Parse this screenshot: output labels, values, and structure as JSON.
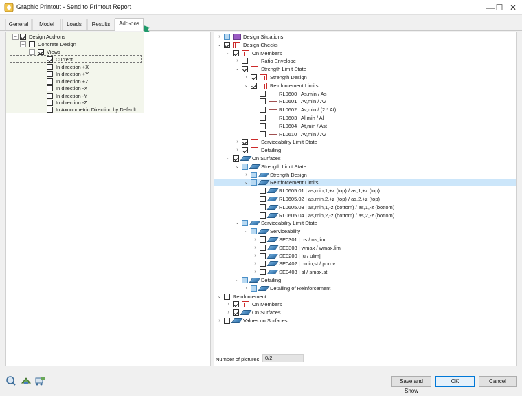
{
  "window": {
    "title": "Graphic Printout - Send to Printout Report",
    "minimize": "—",
    "maximize": "☐",
    "close": "✕"
  },
  "tabs": [
    {
      "label": "General"
    },
    {
      "label": "Model"
    },
    {
      "label": "Loads"
    },
    {
      "label": "Results"
    },
    {
      "label": "Add-ons"
    }
  ],
  "left_tree": [
    {
      "label": "Design Add-ons",
      "checked": true
    },
    {
      "label": "Concrete Design",
      "checked": false
    },
    {
      "label": "Views",
      "checked": true
    },
    {
      "label": "Current",
      "checked": true
    },
    {
      "label": "In direction +X",
      "checked": false
    },
    {
      "label": "In direction +Y",
      "checked": false
    },
    {
      "label": "In direction +Z",
      "checked": false
    },
    {
      "label": "In direction -X",
      "checked": false
    },
    {
      "label": "In direction -Y",
      "checked": false
    },
    {
      "label": "In direction -Z",
      "checked": false
    },
    {
      "label": "In Axonometric Direction by Default",
      "checked": false
    }
  ],
  "right_tree": [
    {
      "label": "Design Situations",
      "state": "partial",
      "icon": "design-situations-icon",
      "toggle": "›"
    },
    {
      "label": "Design Checks",
      "state": "checked",
      "icon": "frame-icon",
      "toggle": "⌄"
    },
    {
      "label": "On Members",
      "state": "checked",
      "icon": "frame-icon",
      "toggle": "⌄"
    },
    {
      "label": "Ratio Envelope",
      "state": "unchecked",
      "icon": "frame-icon",
      "toggle": "›"
    },
    {
      "label": "Strength Limit State",
      "state": "checked",
      "icon": "frame-icon",
      "toggle": "⌄"
    },
    {
      "label": "Strength Design",
      "state": "checked",
      "icon": "frame-icon",
      "toggle": "›"
    },
    {
      "label": "Reinforcement Limits",
      "state": "checked",
      "icon": "frame-icon",
      "toggle": "⌄"
    },
    {
      "label": "RL0600 | As,min / As",
      "state": "unchecked",
      "icon": "line-icon",
      "toggle": ""
    },
    {
      "label": "RL0601 | Av,min / Av",
      "state": "unchecked",
      "icon": "line-icon",
      "toggle": ""
    },
    {
      "label": "RL0602 | Av,min / (2 * At)",
      "state": "unchecked",
      "icon": "line-icon",
      "toggle": ""
    },
    {
      "label": "RL0603 | Al,min / Al",
      "state": "unchecked",
      "icon": "line-icon",
      "toggle": ""
    },
    {
      "label": "RL0604 | At,min / Ast",
      "state": "unchecked",
      "icon": "line-icon",
      "toggle": ""
    },
    {
      "label": "RL0610 | Av,min / Av",
      "state": "unchecked",
      "icon": "line-icon",
      "toggle": ""
    },
    {
      "label": "Serviceability Limit State",
      "state": "checked",
      "icon": "frame-icon",
      "toggle": "›"
    },
    {
      "label": "Detailing",
      "state": "checked",
      "icon": "frame-icon",
      "toggle": "›"
    },
    {
      "label": "On Surfaces",
      "state": "checked",
      "icon": "surface-icon",
      "toggle": "⌄"
    },
    {
      "label": "Strength Limit State",
      "state": "partial",
      "icon": "surface-icon",
      "toggle": "⌄"
    },
    {
      "label": "Strength Design",
      "state": "partial",
      "icon": "surface-icon",
      "toggle": "›"
    },
    {
      "label": "Reinforcement Limits",
      "state": "partial",
      "icon": "surface-icon",
      "toggle": "⌄",
      "selected": true
    },
    {
      "label": "RL0605.01 | as,min,1,+z (top) / as,1,+z (top)",
      "state": "unchecked",
      "icon": "surface-icon",
      "toggle": ""
    },
    {
      "label": "RL0605.02 | as,min,2,+z (top) / as,2,+z (top)",
      "state": "unchecked",
      "icon": "surface-icon",
      "toggle": ""
    },
    {
      "label": "RL0605.03 | as,min,1,-z (bottom) / as,1,-z (bottom)",
      "state": "unchecked",
      "icon": "surface-icon",
      "toggle": ""
    },
    {
      "label": "RL0605.04 | as,min,2,-z (bottom) / as,2,-z (bottom)",
      "state": "unchecked",
      "icon": "surface-icon",
      "toggle": ""
    },
    {
      "label": "Serviceability Limit State",
      "state": "partial",
      "icon": "surface-icon",
      "toggle": "⌄"
    },
    {
      "label": "Serviceability",
      "state": "partial",
      "icon": "surface-icon",
      "toggle": "⌄"
    },
    {
      "label": "SE0301 | σs / σs,lim",
      "state": "unchecked",
      "icon": "surface-icon",
      "toggle": "›"
    },
    {
      "label": "SE0303 | wmax / wmax,lim",
      "state": "unchecked",
      "icon": "surface-icon",
      "toggle": "›"
    },
    {
      "label": "SE0200 | |u / ulim|",
      "state": "unchecked",
      "icon": "surface-icon",
      "toggle": "›"
    },
    {
      "label": "SE0402 | ρmin,st / ρprov",
      "state": "unchecked",
      "icon": "surface-icon",
      "toggle": "›"
    },
    {
      "label": "SE0403 | sl / smax,st",
      "state": "unchecked",
      "icon": "surface-icon",
      "toggle": "›"
    },
    {
      "label": "Detailing",
      "state": "partial",
      "icon": "surface-icon",
      "toggle": "⌄"
    },
    {
      "label": "Detailing of Reinforcement",
      "state": "partial",
      "icon": "surface-icon",
      "toggle": "›"
    },
    {
      "label": "Reinforcement",
      "state": "unchecked",
      "icon": "",
      "toggle": "⌄"
    },
    {
      "label": "On Members",
      "state": "checked",
      "icon": "frame-icon",
      "toggle": "›"
    },
    {
      "label": "On Surfaces",
      "state": "checked",
      "icon": "surface-icon",
      "toggle": "›"
    },
    {
      "label": "Values on Surfaces",
      "state": "unchecked",
      "icon": "surface-icon",
      "toggle": "›"
    }
  ],
  "status": {
    "label": "Number of pictures:",
    "value": "0/2"
  },
  "buttons": {
    "save_show": "Save and Show",
    "ok": "OK",
    "cancel": "Cancel"
  },
  "colors": {
    "accent": "#0078d7",
    "selection": "#cce6fa",
    "arrow": "#1f9a6a",
    "member_icon": "#cc2a2a",
    "surface_icon": "#3b7bb8"
  }
}
